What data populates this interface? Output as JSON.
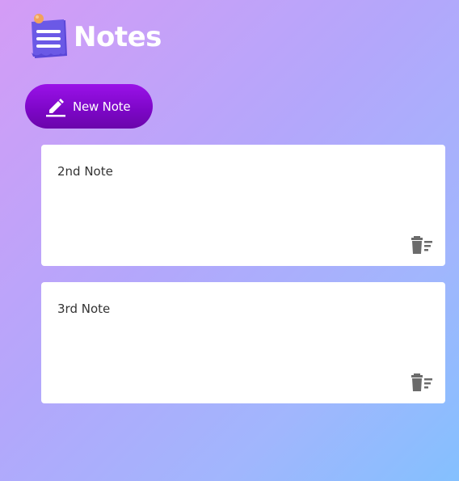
{
  "header": {
    "title": "Notes",
    "logo_icon": "notepad-icon"
  },
  "toolbar": {
    "new_note_label": "New Note",
    "new_note_icon": "pencil-icon"
  },
  "notes": [
    {
      "text": "2nd Note",
      "delete_icon": "trash-icon"
    },
    {
      "text": "3rd Note",
      "delete_icon": "trash-icon"
    }
  ],
  "colors": {
    "accent": "#8a0ad8",
    "logo": "#6e5ee8",
    "pin": "#f2a25c",
    "icon_gray": "#6b6b6b"
  }
}
